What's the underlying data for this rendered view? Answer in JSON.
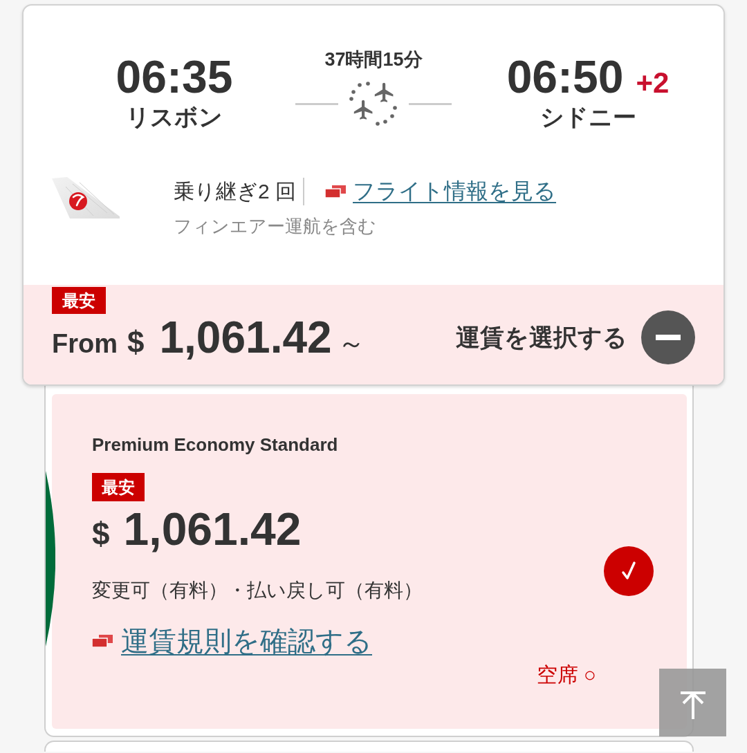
{
  "flight": {
    "departure": {
      "time": "06:35",
      "city": "リスボン"
    },
    "duration": "37時間15分",
    "arrival": {
      "time": "06:50",
      "day_offset": "+2",
      "city": "シドニー"
    },
    "connections": "乗り継ぎ2 回",
    "flight_info_link": "フライト情報を見る",
    "operator_note": "フィンエアー運航を含む"
  },
  "price_summary": {
    "badge": "最安",
    "from_label": "From",
    "currency": "$",
    "amount": "1,061.42",
    "suffix": "～",
    "select_label": "運賃を選択する",
    "expanded": true
  },
  "fares": [
    {
      "name": "Premium Economy Standard",
      "badge": "最安",
      "currency": "$",
      "amount": "1,061.42",
      "conditions": "変更可（有料）・払い戻し可（有料）",
      "rules_link": "運賃規則を確認する",
      "availability": "空席 ○",
      "selected": true
    }
  ]
}
